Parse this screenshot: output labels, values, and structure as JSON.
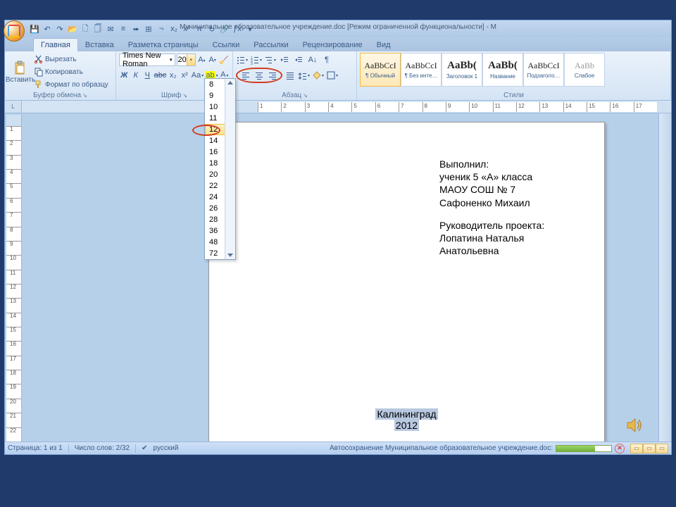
{
  "titlebar": {
    "text": "Муниципальное образовательное учреждение.doc [Режим ограниченной функциональности] - M"
  },
  "qat": {
    "save": "💾",
    "undo": "↶",
    "redo": "↷",
    "open": "📂",
    "new": "🗋",
    "copy": "🗍",
    "mail": "✉",
    "indent_dec": "≡",
    "indent_inc": "➠",
    "insert": "⊞",
    "break": "¬",
    "sub": "x₂",
    "sup": "x²",
    "pi": "π",
    "refresh": "↻",
    "link": "🔗",
    "fx": "ƒx",
    "dd": "▾"
  },
  "tabs": {
    "home": "Главная",
    "insert": "Вставка",
    "layout": "Разметка страницы",
    "refs": "Ссылки",
    "mail": "Рассылки",
    "review": "Рецензирование",
    "view": "Вид"
  },
  "clipboard": {
    "paste": "Вставить",
    "cut": "Вырезать",
    "copy": "Копировать",
    "format": "Формат по образцу",
    "group": "Буфер обмена"
  },
  "font": {
    "name": "Times New Roman",
    "size": "20",
    "group": "Шриф",
    "sizes": [
      "8",
      "9",
      "10",
      "11",
      "12",
      "14",
      "16",
      "18",
      "20",
      "22",
      "24",
      "26",
      "28",
      "36",
      "48",
      "72"
    ]
  },
  "paragraph": {
    "group": "Абзац"
  },
  "styles": {
    "group": "Стили",
    "items": [
      {
        "preview": "AaBbCcI",
        "name": "¶ Обычный",
        "sel": true,
        "big": false
      },
      {
        "preview": "AaBbCcI",
        "name": "¶ Без инте…",
        "sel": false,
        "big": false
      },
      {
        "preview": "AaBb(",
        "name": "Заголовок 1",
        "sel": false,
        "big": true
      },
      {
        "preview": "AaBb(",
        "name": "Название",
        "sel": false,
        "big": true
      },
      {
        "preview": "AaBbCcI",
        "name": "Подзаголо…",
        "sel": false,
        "big": false
      },
      {
        "preview": "AaBb",
        "name": "Слабое",
        "sel": false,
        "big": false,
        "grey": true
      }
    ]
  },
  "document": {
    "block1": [
      "Выполнил:",
      "ученик 5 «А» класса",
      "МАОУ СОШ № 7",
      "Сафоненко Михаил"
    ],
    "block2": [
      "Руководитель проекта:",
      "Лопатина Наталья",
      "Анатольевна"
    ],
    "footer_city": "Калининград",
    "footer_year": "2012"
  },
  "status": {
    "page": "Страница: 1 из 1",
    "words": "Число слов: 2/32",
    "lang": "русский",
    "autosave": "Автосохранение Муниципальное образовательное учреждение.doc:"
  },
  "ruler_nums": [
    "1",
    "2",
    "3",
    "4",
    "5",
    "6",
    "7",
    "8",
    "9",
    "10",
    "11",
    "12",
    "13",
    "14",
    "15",
    "16",
    "17"
  ],
  "ruler_v": [
    "1",
    "2",
    "3",
    "4",
    "5",
    "6",
    "7",
    "8",
    "9",
    "10",
    "11",
    "12",
    "13",
    "14",
    "15",
    "16",
    "17",
    "18",
    "19",
    "20",
    "21",
    "22"
  ]
}
